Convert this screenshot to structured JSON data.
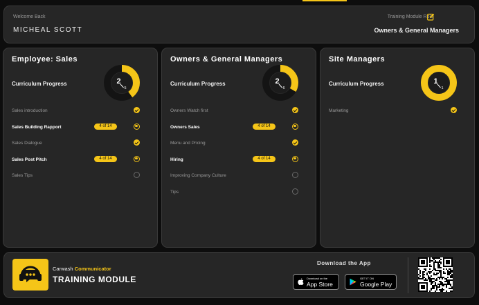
{
  "header": {
    "welcome": "Welcome Back",
    "user_name": "MICHEAL SCOTT",
    "role_label": "Training Module Role",
    "role_value": "Owners & General Managers"
  },
  "cards": [
    {
      "title": "Employee: Sales",
      "progress_label": "Curriculum Progress",
      "done": "2",
      "total": "5",
      "items": [
        {
          "label": "Sales introduction",
          "status": "done",
          "badge": ""
        },
        {
          "label": "Sales Building Rapport",
          "status": "current",
          "badge": "4 of 14"
        },
        {
          "label": "Sales Dialogue",
          "status": "done",
          "badge": ""
        },
        {
          "label": "Sales Post Pitch",
          "status": "current",
          "badge": "4 of 14"
        },
        {
          "label": "Sales Tips",
          "status": "todo",
          "badge": ""
        }
      ]
    },
    {
      "title": "Owners & General Managers",
      "progress_label": "Curriculum Progress",
      "done": "2",
      "total": "6",
      "items": [
        {
          "label": "Owners Watch first",
          "status": "done",
          "badge": ""
        },
        {
          "label": "Owners Sales",
          "status": "current",
          "badge": "4 of 14"
        },
        {
          "label": "Menu and Pricing",
          "status": "done",
          "badge": ""
        },
        {
          "label": "Hiring",
          "status": "current",
          "badge": "4 of 14"
        },
        {
          "label": "Improving Company Culture",
          "status": "todo",
          "badge": ""
        },
        {
          "label": "Tips",
          "status": "todo",
          "badge": ""
        }
      ]
    },
    {
      "title": "Site Managers",
      "progress_label": "Curriculum Progress",
      "done": "1",
      "total": "1",
      "items": [
        {
          "label": "Marketing",
          "status": "done",
          "badge": ""
        }
      ]
    }
  ],
  "footer": {
    "brand_prefix": "Carwash",
    "brand_highlight": "Communicator",
    "module_title": "TRAINING MODULE",
    "download_label": "Download the App",
    "appstore_small": "Download on the",
    "appstore_big": "App Store",
    "gplay_small": "GET IT ON",
    "gplay_big": "Google Play"
  },
  "colors": {
    "accent": "#f5c518",
    "panel": "#262626",
    "background": "#0d0d0d",
    "track": "#141414"
  },
  "icons": {
    "edit": "edit-icon",
    "logo": "headset-chat-icon",
    "apple": "apple-icon",
    "play": "google-play-icon",
    "qr": "qr-code-icon"
  }
}
